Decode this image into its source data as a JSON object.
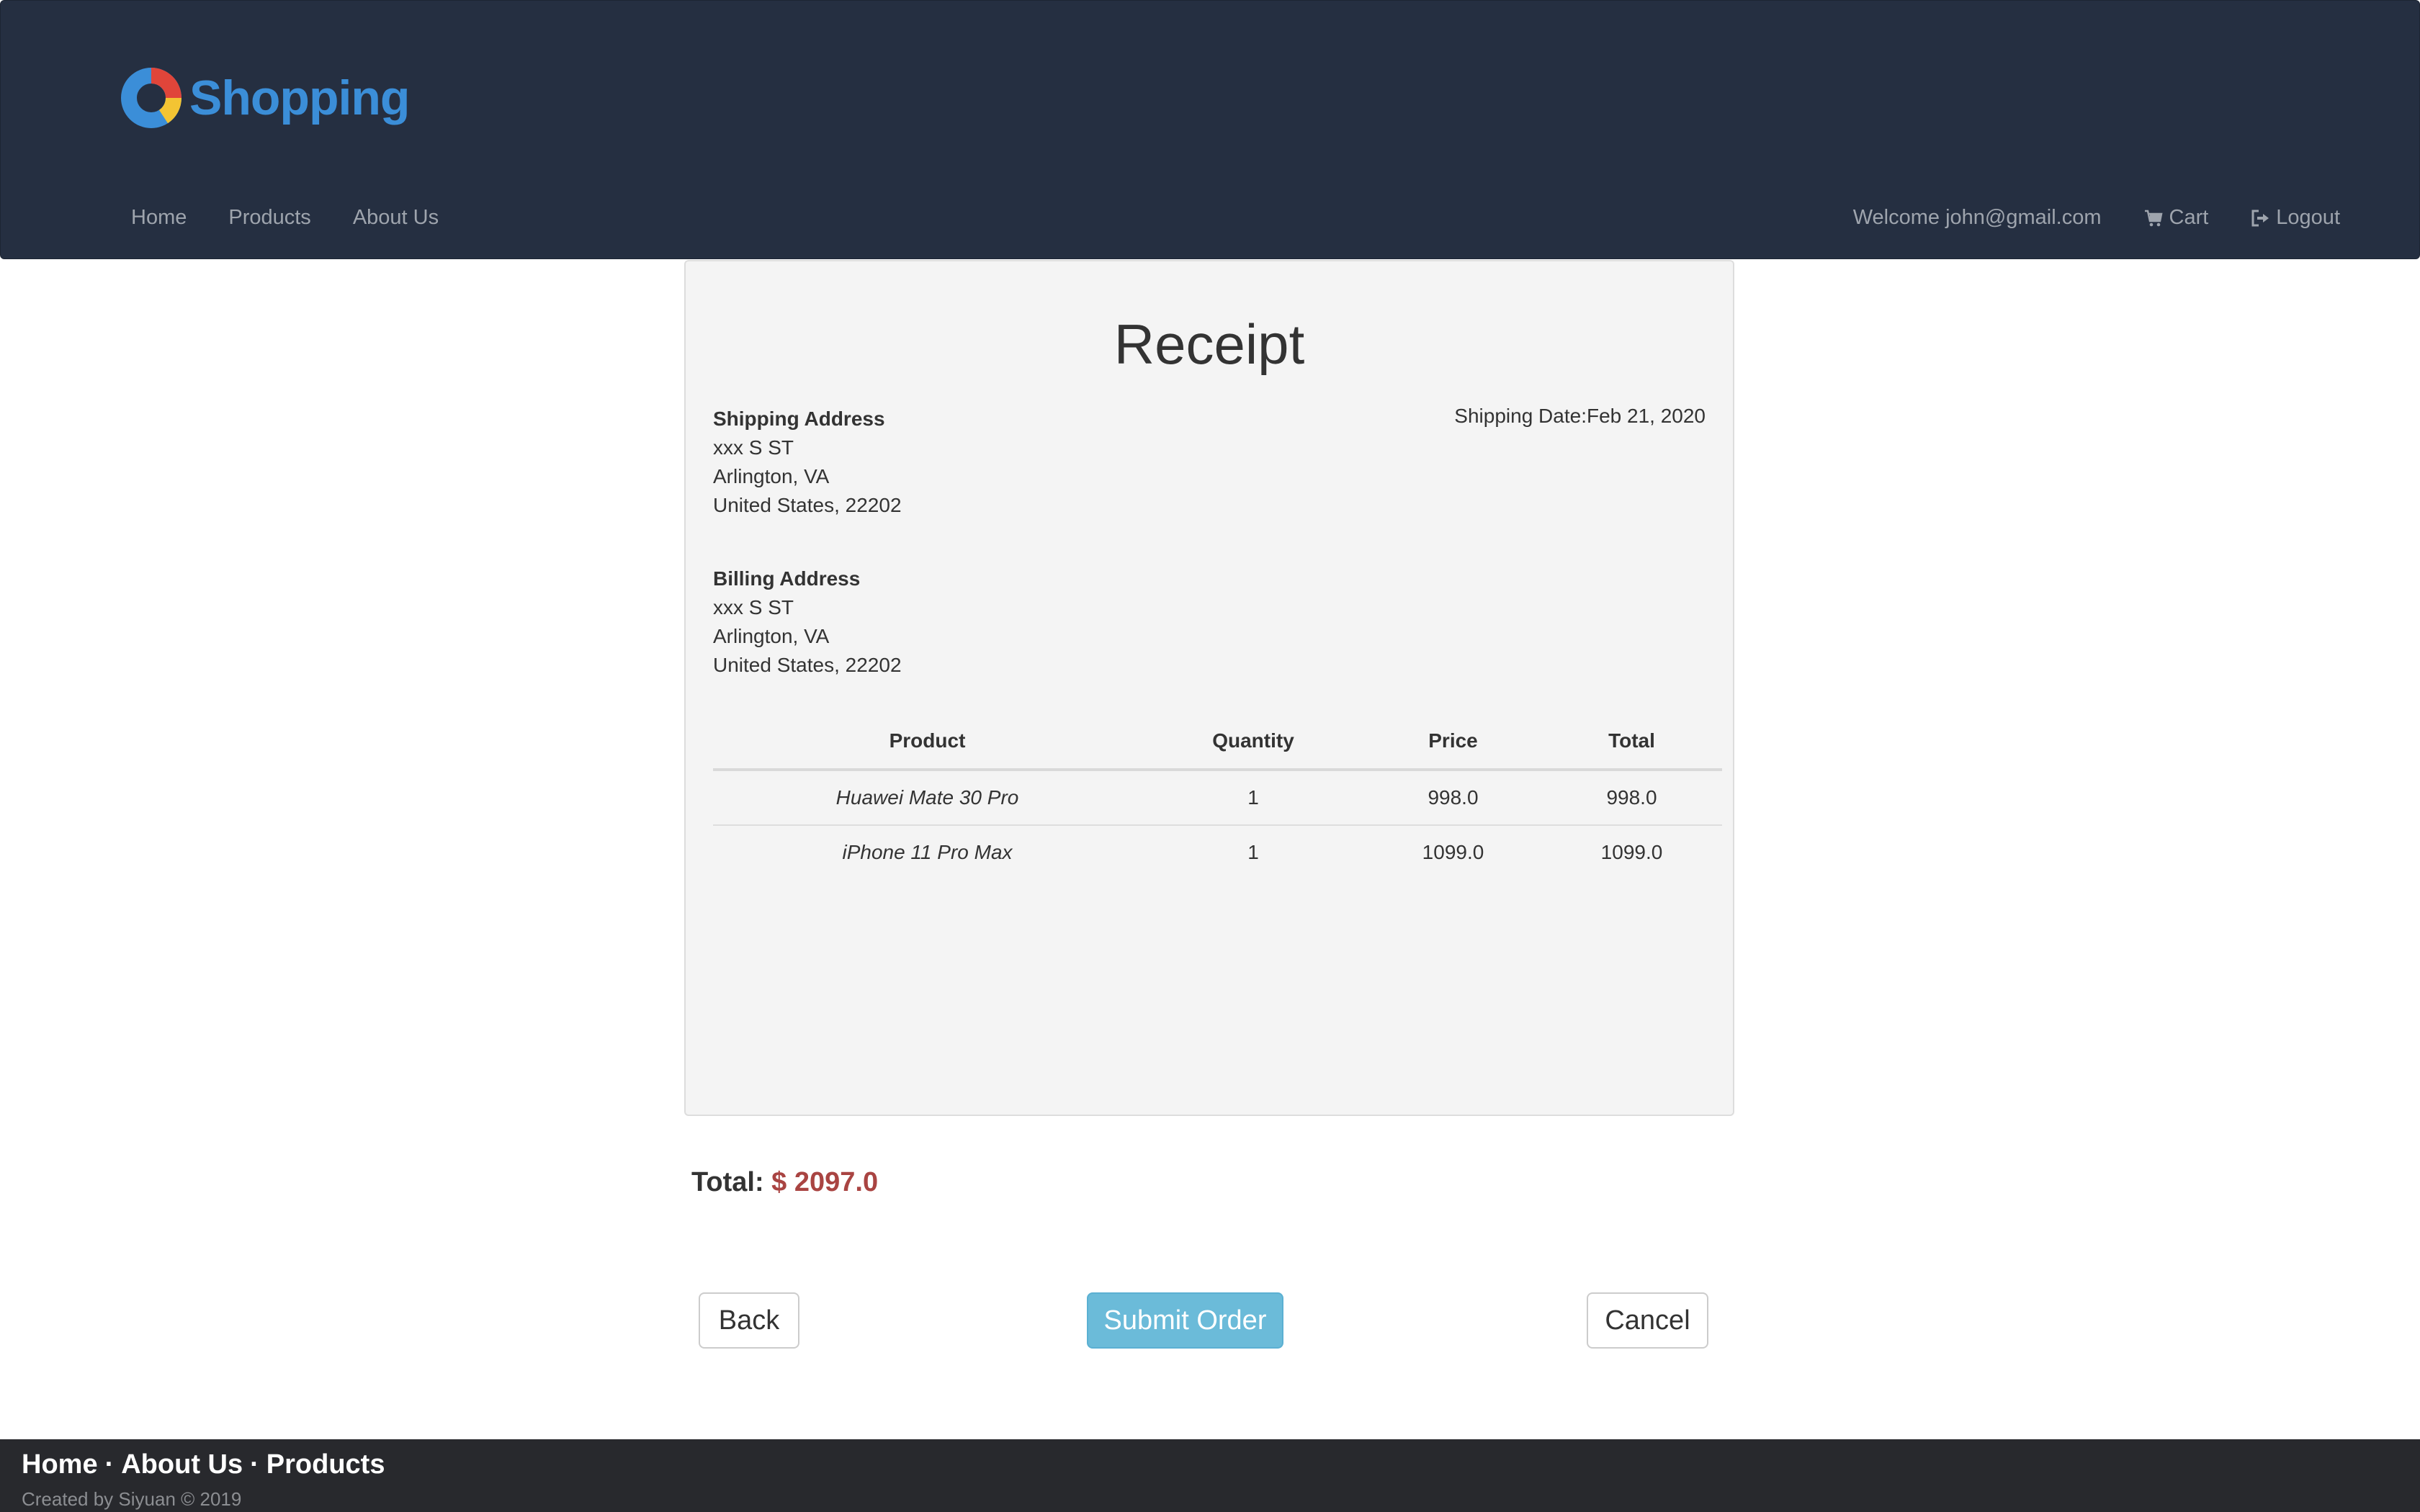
{
  "brand": {
    "name": "Shopping",
    "colors": {
      "ring_blue": "#3b8ed8",
      "ring_red": "#e0453a",
      "ring_yellow": "#f3c433"
    }
  },
  "nav": {
    "left": [
      "Home",
      "Products",
      "About Us"
    ],
    "welcome": "Welcome john@gmail.com",
    "cart": "Cart",
    "logout": "Logout",
    "cart_icon": "cart-icon",
    "logout_icon": "logout-icon"
  },
  "receipt": {
    "title": "Receipt",
    "shipping": {
      "heading": "Shipping Address",
      "line1": "xxx S ST",
      "line2": "Arlington, VA",
      "line3": "United States, 22202"
    },
    "shipping_date": "Shipping Date:Feb 21, 2020",
    "billing": {
      "heading": "Billing Address",
      "line1": "xxx S ST",
      "line2": "Arlington, VA",
      "line3": "United States, 22202"
    },
    "table": {
      "headers": [
        "Product",
        "Quantity",
        "Price",
        "Total"
      ],
      "rows": [
        [
          "Huawei Mate 30 Pro",
          "1",
          "998.0",
          "998.0"
        ],
        [
          "iPhone 11 Pro Max",
          "1",
          "1099.0",
          "1099.0"
        ]
      ]
    },
    "total_label": "Total:",
    "total_value": "$ 2097.0",
    "buttons": {
      "back": "Back",
      "submit": "Submit Order",
      "cancel": "Cancel"
    }
  },
  "footer": {
    "links": [
      "Home",
      "About Us",
      "Products"
    ],
    "separator": "·",
    "credit": "Created by Siyuan © 2019"
  }
}
